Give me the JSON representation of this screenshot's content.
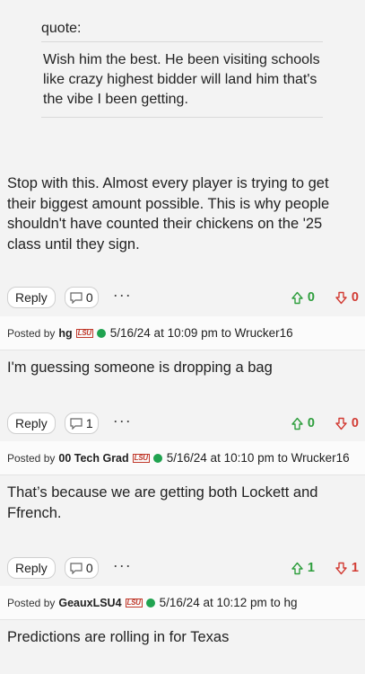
{
  "quote": {
    "label": "quote:",
    "text": "Wish him the best. He been visiting schools like crazy highest bidder will land him that's the vibe I been getting."
  },
  "original_post": {
    "body": "Stop with this. Almost every player is trying to get their biggest amount possible. This is why people shouldn't have counted their chickens on the '25 class until they sign.",
    "reply_label": "Reply",
    "comment_count": "0",
    "more": "···",
    "upvotes": "0",
    "downvotes": "0"
  },
  "replies": [
    {
      "posted_by_label": "Posted by",
      "author": "hg",
      "badge": "LSU",
      "meta": "5/16/24 at 10:09 pm to Wrucker16",
      "text": "I'm guessing someone is dropping a bag",
      "reply_label": "Reply",
      "comment_count": "1",
      "more": "···",
      "upvotes": "0",
      "downvotes": "0"
    },
    {
      "posted_by_label": "Posted by",
      "author": "00 Tech Grad",
      "badge": "LSU",
      "meta": "5/16/24 at 10:10 pm to Wrucker16",
      "text": "That’s because we are getting both Lockett and Ffrench.",
      "reply_label": "Reply",
      "comment_count": "0",
      "more": "···",
      "upvotes": "1",
      "downvotes": "1"
    },
    {
      "posted_by_label": "Posted by",
      "author": "GeauxLSU4",
      "badge": "LSU",
      "meta": "5/16/24 at 10:12 pm to hg",
      "text": "Predictions are rolling in for Texas"
    }
  ],
  "colors": {
    "upvote": "#2e9e3d",
    "downvote": "#d23b33",
    "online": "#20a350",
    "badge": "#c0392b"
  }
}
